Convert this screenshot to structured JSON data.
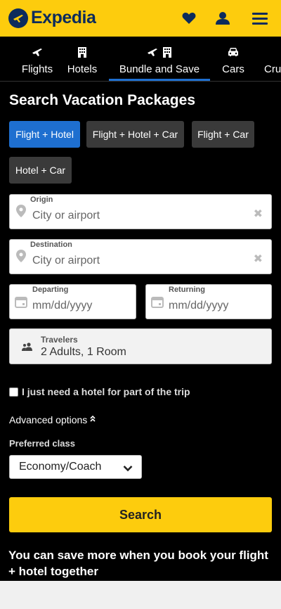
{
  "header": {
    "brand": "Expedia",
    "icons": [
      "heart-icon",
      "account-icon",
      "menu-icon"
    ]
  },
  "tabs": [
    {
      "label": "Flights",
      "icons": [
        "plane-icon"
      ]
    },
    {
      "label": "Hotels",
      "icons": [
        "hotel-icon"
      ]
    },
    {
      "label": "Bundle and Save",
      "icons": [
        "plane-icon",
        "hotel-icon"
      ],
      "active": true
    },
    {
      "label": "Cars",
      "icons": [
        "car-icon"
      ]
    },
    {
      "label": "Cru"
    }
  ],
  "main": {
    "title": "Search Vacation Packages",
    "package_types": [
      "Flight + Hotel",
      "Flight + Hotel + Car",
      "Flight + Car",
      "Hotel + Car"
    ],
    "selected_package": "Flight + Hotel",
    "origin": {
      "label": "Origin",
      "placeholder": "City or airport"
    },
    "destination": {
      "label": "Destination",
      "placeholder": "City or airport"
    },
    "departing": {
      "label": "Departing",
      "placeholder": "mm/dd/yyyy"
    },
    "returning": {
      "label": "Returning",
      "placeholder": "mm/dd/yyyy"
    },
    "travelers": {
      "label": "Travelers",
      "value": "2 Adults, 1 Room"
    },
    "partial_hotel_label": "I just need a hotel for part of the trip",
    "advanced_options_label": "Advanced options",
    "preferred_class_label": "Preferred class",
    "preferred_class_value": "Economy/Coach",
    "search_label": "Search",
    "promo_text": "You can save more when you book your flight + hotel together"
  },
  "colors": {
    "brand_yellow": "#fdcc0d",
    "brand_navy": "#0c2b5c",
    "accent_blue": "#1e6fd0"
  }
}
